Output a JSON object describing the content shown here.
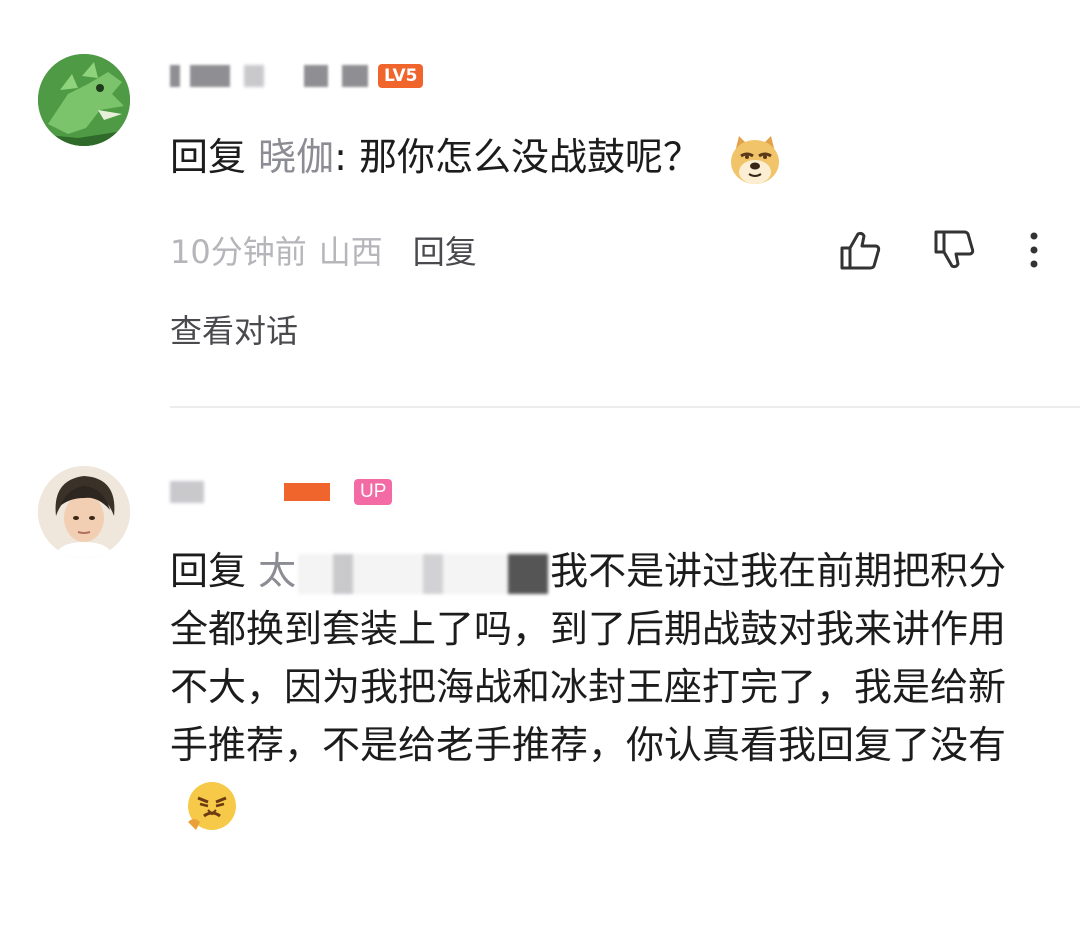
{
  "comment1": {
    "level_badge": "LV5",
    "reply_prefix": "回复",
    "reply_target": "晓伽",
    "body": ": 那你怎么没战鼓呢？",
    "emoji": "doge-emoji",
    "time": "10分钟前",
    "location": "山西",
    "reply_action": "回复",
    "view_conversation": "查看对话"
  },
  "comment2": {
    "badge": "UP",
    "reply_prefix": "回复",
    "reply_target_partial": "太",
    "body": "我不是讲过我在前期把积分全都换到套装上了吗，到了后期战鼓对我来讲作用不大，因为我把海战和冰封王座打完了，我是给新手推荐，不是给老手推荐，你认真看我回复了没有",
    "emoji": "angry-face-emoji"
  },
  "icons": {
    "like": "thumbs-up-icon",
    "dislike": "thumbs-down-icon",
    "more": "more-vertical-icon"
  },
  "colors": {
    "level_badge": "#f0652c",
    "up_badge": "#f36aa4",
    "secondary_text": "#8c8c94"
  }
}
